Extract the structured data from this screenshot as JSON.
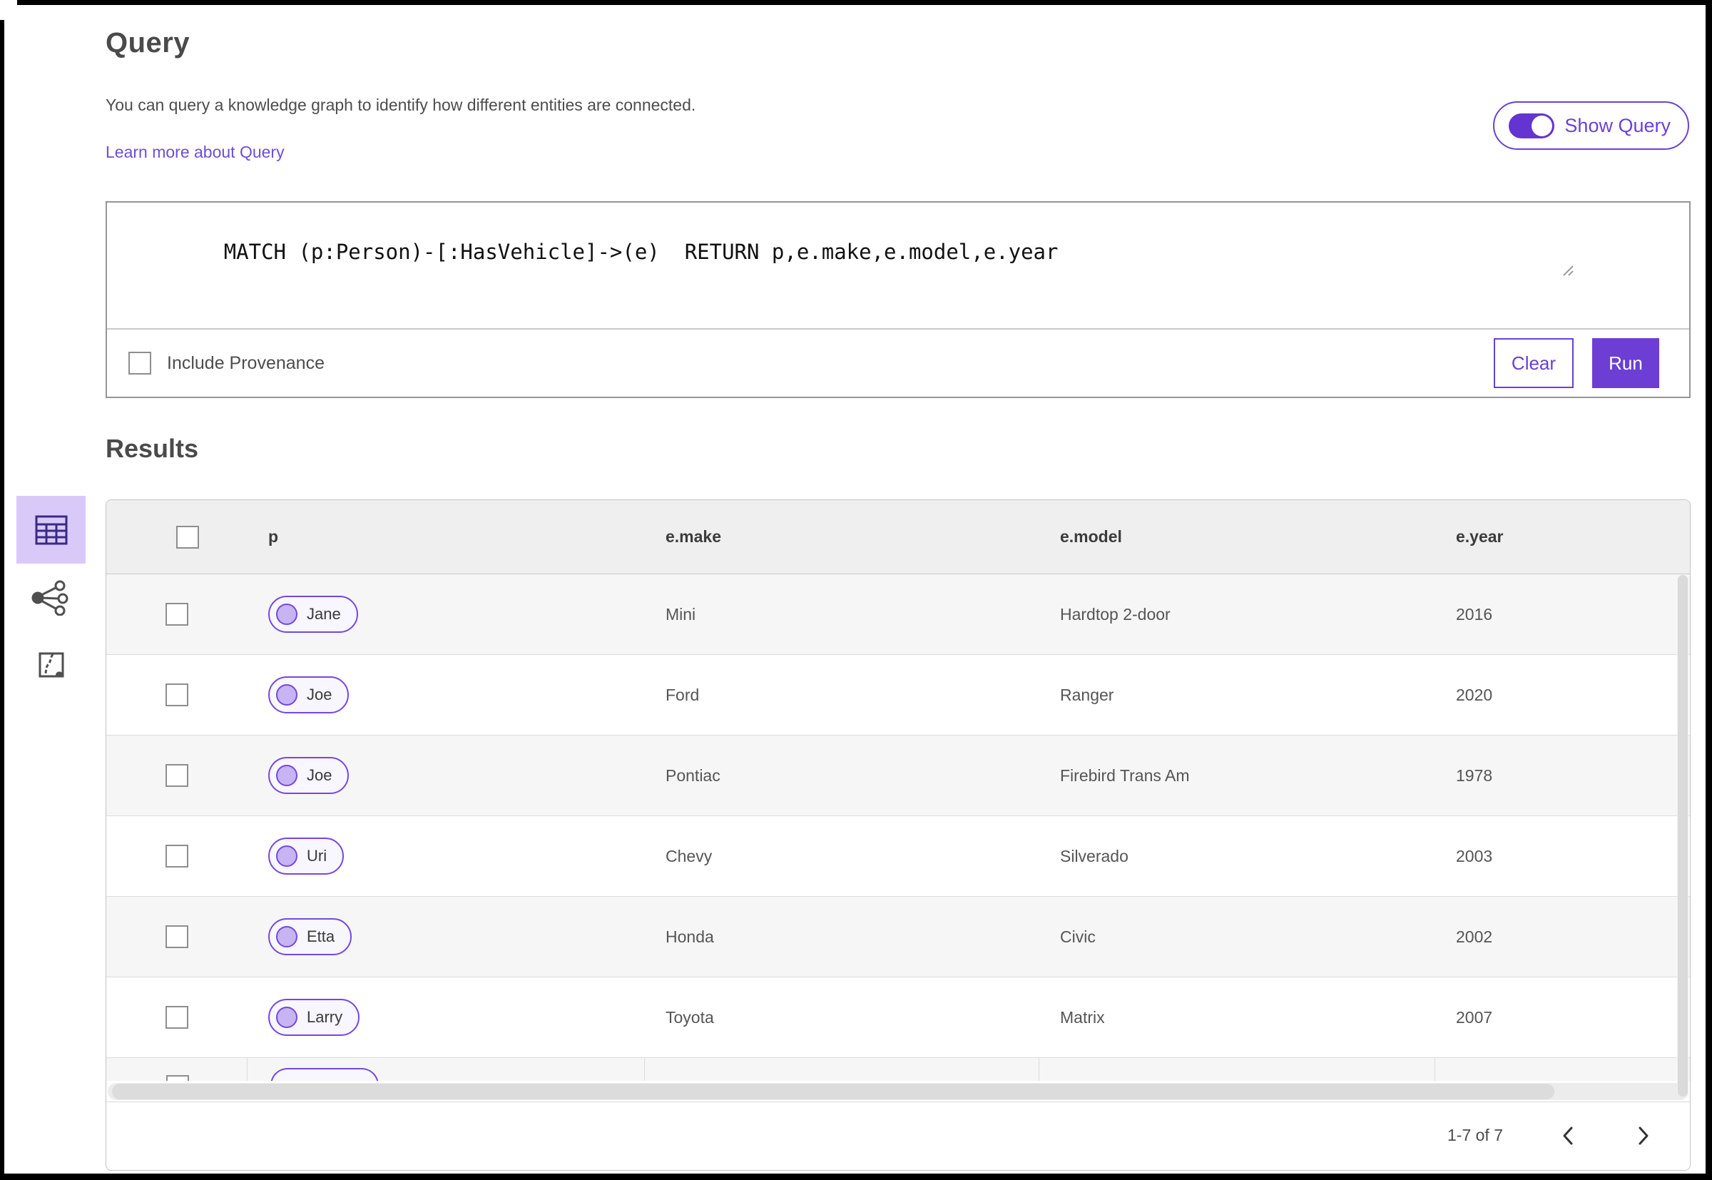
{
  "colors": {
    "accent_purple": "#6c3ed3",
    "pill_border_purple": "#7647e0",
    "pill_fill": "#f8f6fe",
    "selected_view_bg": "#d9c9f8",
    "header_row_bg": "#efefef",
    "alt_row_bg": "#f6f6f6",
    "link_purple": "#6a50d8"
  },
  "query_section": {
    "title": "Query",
    "description": "You can query a knowledge graph to identify how different entities are connected.",
    "learn_more_link": "Learn more about Query",
    "show_query_toggle": {
      "label": "Show Query",
      "state": "on"
    },
    "query_text": "MATCH (p:Person)-[:HasVehicle]->(e)  RETURN p,e.make,e.model,e.year",
    "include_provenance": {
      "label": "Include Provenance",
      "checked": false
    },
    "clear_button": "Clear",
    "run_button": "Run"
  },
  "results_section": {
    "title": "Results",
    "view_switcher": {
      "icons": [
        "table-view-icon",
        "link-chart-view-icon",
        "map-view-icon"
      ],
      "selected": "table-view-icon"
    },
    "table": {
      "columns": {
        "p": "p",
        "make": "e.make",
        "model": "e.model",
        "year": "e.year"
      },
      "rows": [
        {
          "p": "Jane",
          "make": "Mini",
          "model": "Hardtop 2-door",
          "year": "2016"
        },
        {
          "p": "Joe",
          "make": "Ford",
          "model": "Ranger",
          "year": "2020"
        },
        {
          "p": "Joe",
          "make": "Pontiac",
          "model": "Firebird Trans Am",
          "year": "1978"
        },
        {
          "p": "Uri",
          "make": "Chevy",
          "model": "Silverado",
          "year": "2003"
        },
        {
          "p": "Etta",
          "make": "Honda",
          "model": "Civic",
          "year": "2002"
        },
        {
          "p": "Larry",
          "make": "Toyota",
          "model": "Matrix",
          "year": "2007"
        }
      ],
      "partial_row_visible": true
    },
    "pagination": {
      "range_label": "1-7 of 7",
      "prev_icon": "chevron-left-icon",
      "next_icon": "chevron-right-icon"
    }
  }
}
